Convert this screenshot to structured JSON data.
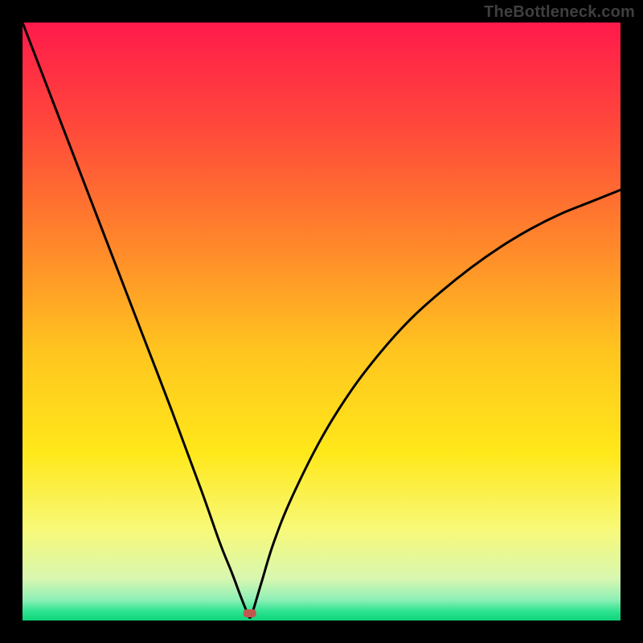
{
  "watermark": "TheBottleneck.com",
  "chart_data": {
    "type": "line",
    "title": "",
    "xlabel": "",
    "ylabel": "",
    "xlim": [
      0,
      100
    ],
    "ylim": [
      0,
      100
    ],
    "minimum_x": 38,
    "marker": {
      "x": 38,
      "y": 1.2
    },
    "series": [
      {
        "name": "bottleneck-curve",
        "x": [
          0,
          5,
          10,
          15,
          20,
          25,
          30,
          33,
          35,
          36.5,
          37.5,
          38,
          38.5,
          40,
          42,
          45,
          50,
          55,
          60,
          65,
          70,
          75,
          80,
          85,
          90,
          95,
          100
        ],
        "values": [
          100,
          87,
          74,
          61,
          48,
          35,
          21.5,
          13,
          8,
          4,
          1.5,
          0.5,
          1.5,
          6.5,
          13,
          20.5,
          30.5,
          38.5,
          45,
          50.5,
          55,
          59,
          62.5,
          65.5,
          68,
          70,
          72
        ]
      }
    ],
    "gradient_stops": [
      {
        "offset": 0,
        "color": "#ff1a4b"
      },
      {
        "offset": 0.18,
        "color": "#ff4a3a"
      },
      {
        "offset": 0.38,
        "color": "#ff8a2a"
      },
      {
        "offset": 0.55,
        "color": "#ffc51f"
      },
      {
        "offset": 0.72,
        "color": "#ffe81a"
      },
      {
        "offset": 0.85,
        "color": "#f7f97a"
      },
      {
        "offset": 0.93,
        "color": "#d8f7b0"
      },
      {
        "offset": 0.965,
        "color": "#8ef0b6"
      },
      {
        "offset": 0.985,
        "color": "#2de38f"
      },
      {
        "offset": 1.0,
        "color": "#0fd47a"
      }
    ],
    "marker_color": "#c1584f"
  }
}
